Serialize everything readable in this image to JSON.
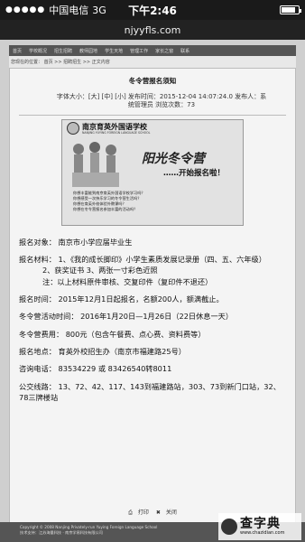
{
  "status_bar": {
    "carrier": "中国电信",
    "network": "3G",
    "time": "下午2:46",
    "battery_level": 0.85
  },
  "browser": {
    "url": "njyyfls.com"
  },
  "site": {
    "nav_items": [
      "首页",
      "学校概况",
      "招生招聘",
      "教师园地",
      "学生天地",
      "管理工作",
      "家长之窗",
      "联系"
    ],
    "breadcrumb": "您现在的位置：  首页 >> 招聘招生 >> 正文内容"
  },
  "article": {
    "title": "冬令营报名须知",
    "meta_line1": "字体大小：[大] [中] [小] 发布时间：2015-12-04 14:07:24.0 发布人：系",
    "meta_line2": "统管理员  浏览次数：73",
    "poster": {
      "school": "南京育英外国语学校",
      "school_en": "NANJING YUYING FOREIGN LANGUAGE SCHOOL",
      "slogan": "阳光冬令营",
      "signup": "……开始报名啦！",
      "bullets": [
        "你想丰富能到南京育英外国语学校学习吗？",
        "你想感受一次快乐学习的冬令营生活吗？",
        "你想在育英外校体验外教课吗？",
        "你想在冬令营报名参加丰富的活动吗？"
      ]
    },
    "lines": {
      "target": "报名对象：  南京市小学应届毕业生",
      "materials": "报名材料：  1、《我的成长脚印》小学生素质发展记录册（四、五、六年级）",
      "materials2": "2、获奖证书     3、两张一寸彩色近照",
      "materials_note": "注：以上材料原件审核、交复印件（复印件不退还）",
      "time": "报名时间：  2015年12月1日起报名，名额200人，额满截止。",
      "camp_time": "冬令营活动时间：  2016年1月20日—1月26日（22日休息一天）",
      "fee": "冬令营费用：  800元（包含午餐费、点心费、资料费等）",
      "location": "报名地点：  育英外校招生办（南京市福建路25号）",
      "phone": "咨询电话：  83534229 或 83426540转8011",
      "bus": "公交线路：  13、72、42、117、143到福建路站，303、73到新门口站，32、78三牌楼站"
    },
    "actions": {
      "print": "打印",
      "close": "关闭"
    }
  },
  "footer": {
    "line1": "Copyright © 2008 Nanjing Privately-run Yuying Foreign Language School",
    "line2": "技术支持：江苏海量科技 · 南京学易科技有限公司"
  },
  "watermark": {
    "title": "查字典",
    "url": "www.chazidian.com"
  }
}
